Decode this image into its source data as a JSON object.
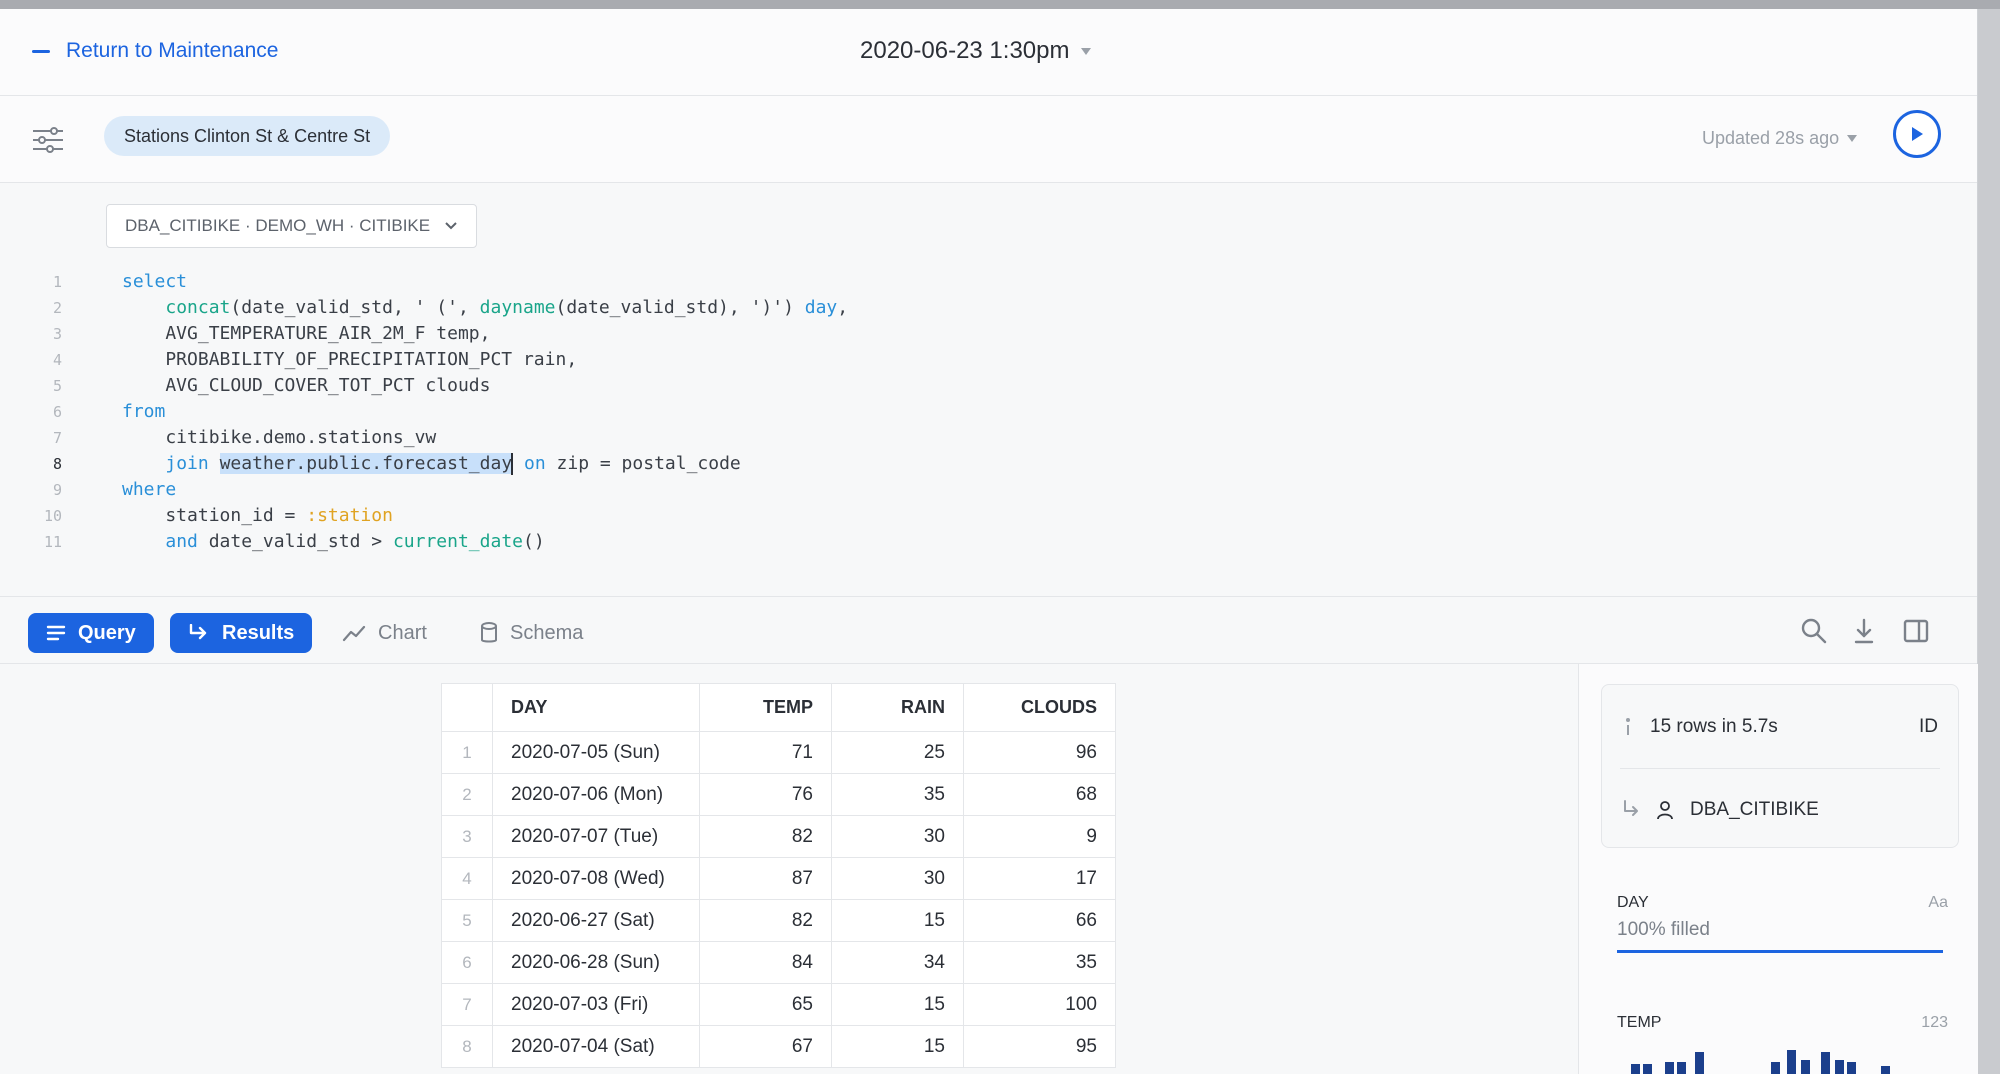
{
  "header": {
    "back_label": "Return to Maintenance",
    "datetime": "2020-06-23 1:30pm"
  },
  "filterbar": {
    "station_pill": "Stations Clinton St & Centre St",
    "updated": "Updated 28s ago"
  },
  "editor": {
    "context": "DBA_CITIBIKE · DEMO_WH · CITIBIKE",
    "line_numbers": [
      "1",
      "2",
      "3",
      "4",
      "5",
      "6",
      "7",
      "8",
      "9",
      "10",
      "11"
    ]
  },
  "tabs": {
    "query": "Query",
    "results": "Results",
    "chart": "Chart",
    "schema": "Schema"
  },
  "table": {
    "headers": [
      "DAY",
      "TEMP",
      "RAIN",
      "CLOUDS"
    ],
    "rows": [
      {
        "n": "1",
        "day": "2020-07-05 (Sun)",
        "temp": "71",
        "rain": "25",
        "clouds": "96"
      },
      {
        "n": "2",
        "day": "2020-07-06 (Mon)",
        "temp": "76",
        "rain": "35",
        "clouds": "68"
      },
      {
        "n": "3",
        "day": "2020-07-07 (Tue)",
        "temp": "82",
        "rain": "30",
        "clouds": "9"
      },
      {
        "n": "4",
        "day": "2020-07-08 (Wed)",
        "temp": "87",
        "rain": "30",
        "clouds": "17"
      },
      {
        "n": "5",
        "day": "2020-06-27 (Sat)",
        "temp": "82",
        "rain": "15",
        "clouds": "66"
      },
      {
        "n": "6",
        "day": "2020-06-28 (Sun)",
        "temp": "84",
        "rain": "34",
        "clouds": "35"
      },
      {
        "n": "7",
        "day": "2020-07-03 (Fri)",
        "temp": "65",
        "rain": "15",
        "clouds": "100"
      },
      {
        "n": "8",
        "day": "2020-07-04 (Sat)",
        "temp": "67",
        "rain": "15",
        "clouds": "95"
      }
    ]
  },
  "side": {
    "rows_info": "15 rows in 5.7s",
    "id_label": "ID",
    "role": "DBA_CITIBIKE",
    "col1_title": "DAY",
    "col1_type": "Aa",
    "col1_fill": "100% filled",
    "col1_fill_fraction": 1.0,
    "col2_title": "TEMP",
    "col2_type": "123"
  },
  "colors": {
    "accent": "#1c64e0",
    "keyword": "#2a8fd8",
    "function": "#1aa58a",
    "param": "#e0a322",
    "pill_bg": "#dbeaf9",
    "histogram": "#1b3f8c"
  }
}
